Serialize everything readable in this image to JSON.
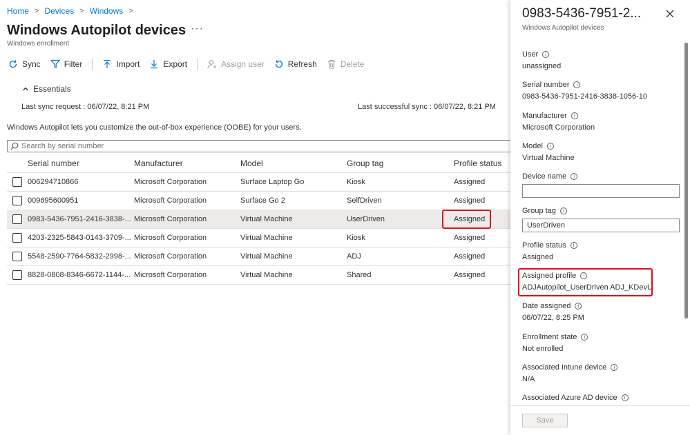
{
  "breadcrumb": [
    "Home",
    "Devices",
    "Windows"
  ],
  "page": {
    "title": "Windows Autopilot devices",
    "more": "···",
    "subtitle": "Windows enrollment"
  },
  "toolbar": {
    "sync": "Sync",
    "filter": "Filter",
    "import": "Import",
    "export": "Export",
    "assign_user": "Assign user",
    "refresh": "Refresh",
    "delete": "Delete"
  },
  "essentials": {
    "label": "Essentials",
    "last_sync": "Last sync request : 06/07/22, 8:21 PM",
    "last_success": "Last successful sync : 06/07/22, 8:21 PM"
  },
  "description": "Windows Autopilot lets you customize the out-of-box experience (OOBE) for your users.",
  "search": {
    "placeholder": "Search by serial number"
  },
  "table": {
    "headers": [
      "Serial number",
      "Manufacturer",
      "Model",
      "Group tag",
      "Profile status"
    ],
    "rows": [
      [
        "006294710866",
        "Microsoft Corporation",
        "Surface Laptop Go",
        "Kiosk",
        "Assigned"
      ],
      [
        "009695600951",
        "Microsoft Corporation",
        "Surface Go 2",
        "SelfDriven",
        "Assigned"
      ],
      [
        "0983-5436-7951-2416-3838-...",
        "Microsoft Corporation",
        "Virtual Machine",
        "UserDriven",
        "Assigned"
      ],
      [
        "4203-2325-5843-0143-3709-...",
        "Microsoft Corporation",
        "Virtual Machine",
        "Kiosk",
        "Assigned"
      ],
      [
        "5548-2590-7764-5832-2998-...",
        "Microsoft Corporation",
        "Virtual Machine",
        "ADJ",
        "Assigned"
      ],
      [
        "8828-0808-8346-6672-1144-...",
        "Microsoft Corporation",
        "Virtual Machine",
        "Shared",
        "Assigned"
      ]
    ]
  },
  "panel": {
    "title": "0983-5436-7951-2...",
    "subtitle": "Windows Autopilot devices",
    "user_label": "User",
    "user_value": "unassigned",
    "serial_label": "Serial number",
    "serial_value": "0983-5436-7951-2416-3838-1056-10",
    "manufacturer_label": "Manufacturer",
    "manufacturer_value": "Microsoft Corporation",
    "model_label": "Model",
    "model_value": "Virtual Machine",
    "device_name_label": "Device name",
    "device_name_value": "",
    "group_tag_label": "Group tag",
    "group_tag_value": "UserDriven",
    "profile_status_label": "Profile status",
    "profile_status_value": "Assigned",
    "assigned_profile_label": "Assigned profile",
    "assigned_profile_value": "ADJAutopilot_UserDriven ADJ_KDevU",
    "date_assigned_label": "Date assigned",
    "date_assigned_value": "06/07/22, 8:25 PM",
    "enrollment_label": "Enrollment state",
    "enrollment_value": "Not enrolled",
    "intune_label": "Associated Intune device",
    "intune_value": "N/A",
    "azure_label": "Associated Azure AD device",
    "save": "Save"
  },
  "colors": {
    "accent": "#0078d4",
    "highlight": "#e00b1c",
    "selected_row": "#edebe9"
  }
}
